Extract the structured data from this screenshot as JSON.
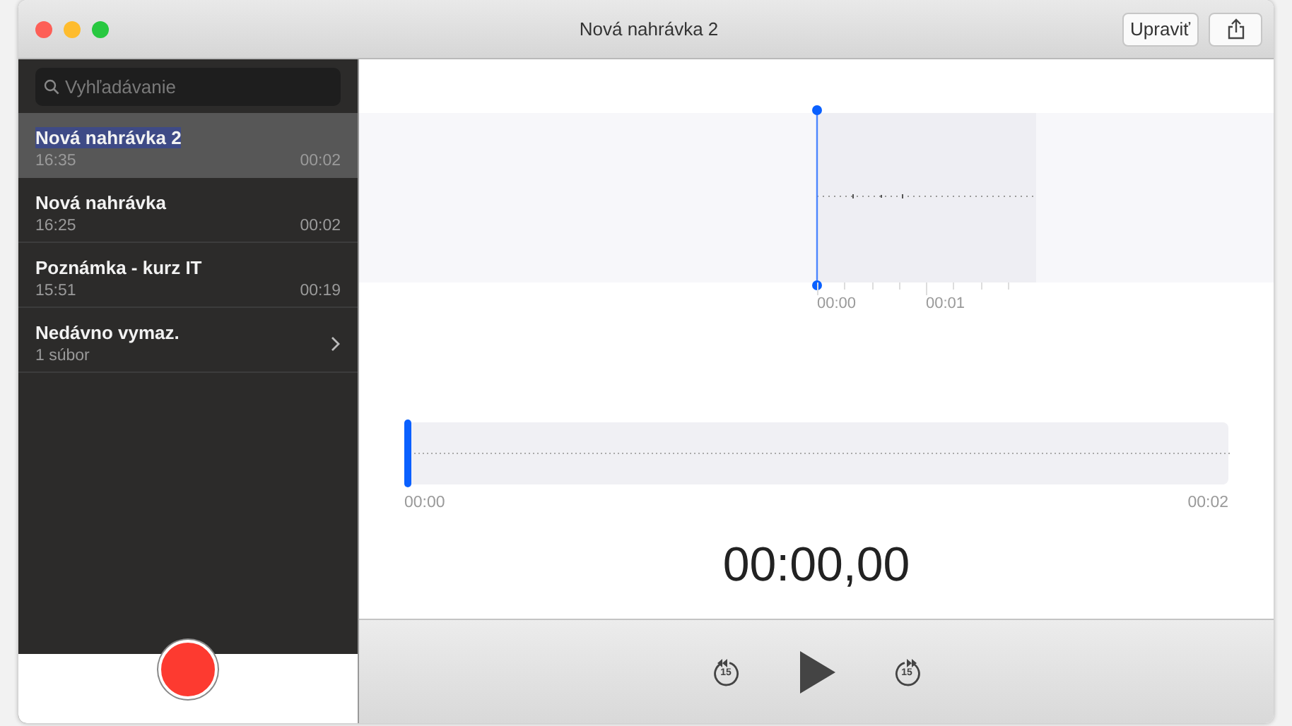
{
  "window": {
    "title": "Nová nahrávka 2",
    "buttons": [
      {
        "kind": "text",
        "label": "Upraviť"
      },
      {
        "kind": "share"
      }
    ]
  },
  "search": {
    "placeholder": "Vyhľadávanie"
  },
  "recordings": [
    {
      "kind": "recording",
      "title": "Nová nahrávka 2",
      "time": "16:35",
      "duration": "00:02",
      "selected": true
    },
    {
      "kind": "recording",
      "title": "Nová nahrávka",
      "time": "16:25",
      "duration": "00:02",
      "selected": false
    },
    {
      "kind": "recording",
      "title": "Poznámka - kurz IT",
      "time": "15:51",
      "duration": "00:19",
      "selected": false
    },
    {
      "kind": "folder",
      "title": "Nedávno vymaz.",
      "subtitle": "1 súbor",
      "selected": false
    }
  ],
  "waveform": {
    "ticks": [
      "00:00",
      "00:01"
    ]
  },
  "scrubber": {
    "level": 0,
    "start": "00:00",
    "end": "00:02"
  },
  "current_time": "00:00,00",
  "controls": [
    {
      "kind": "skip-back",
      "label": "15"
    },
    {
      "kind": "play"
    },
    {
      "kind": "skip-forward",
      "label": "15"
    }
  ]
}
